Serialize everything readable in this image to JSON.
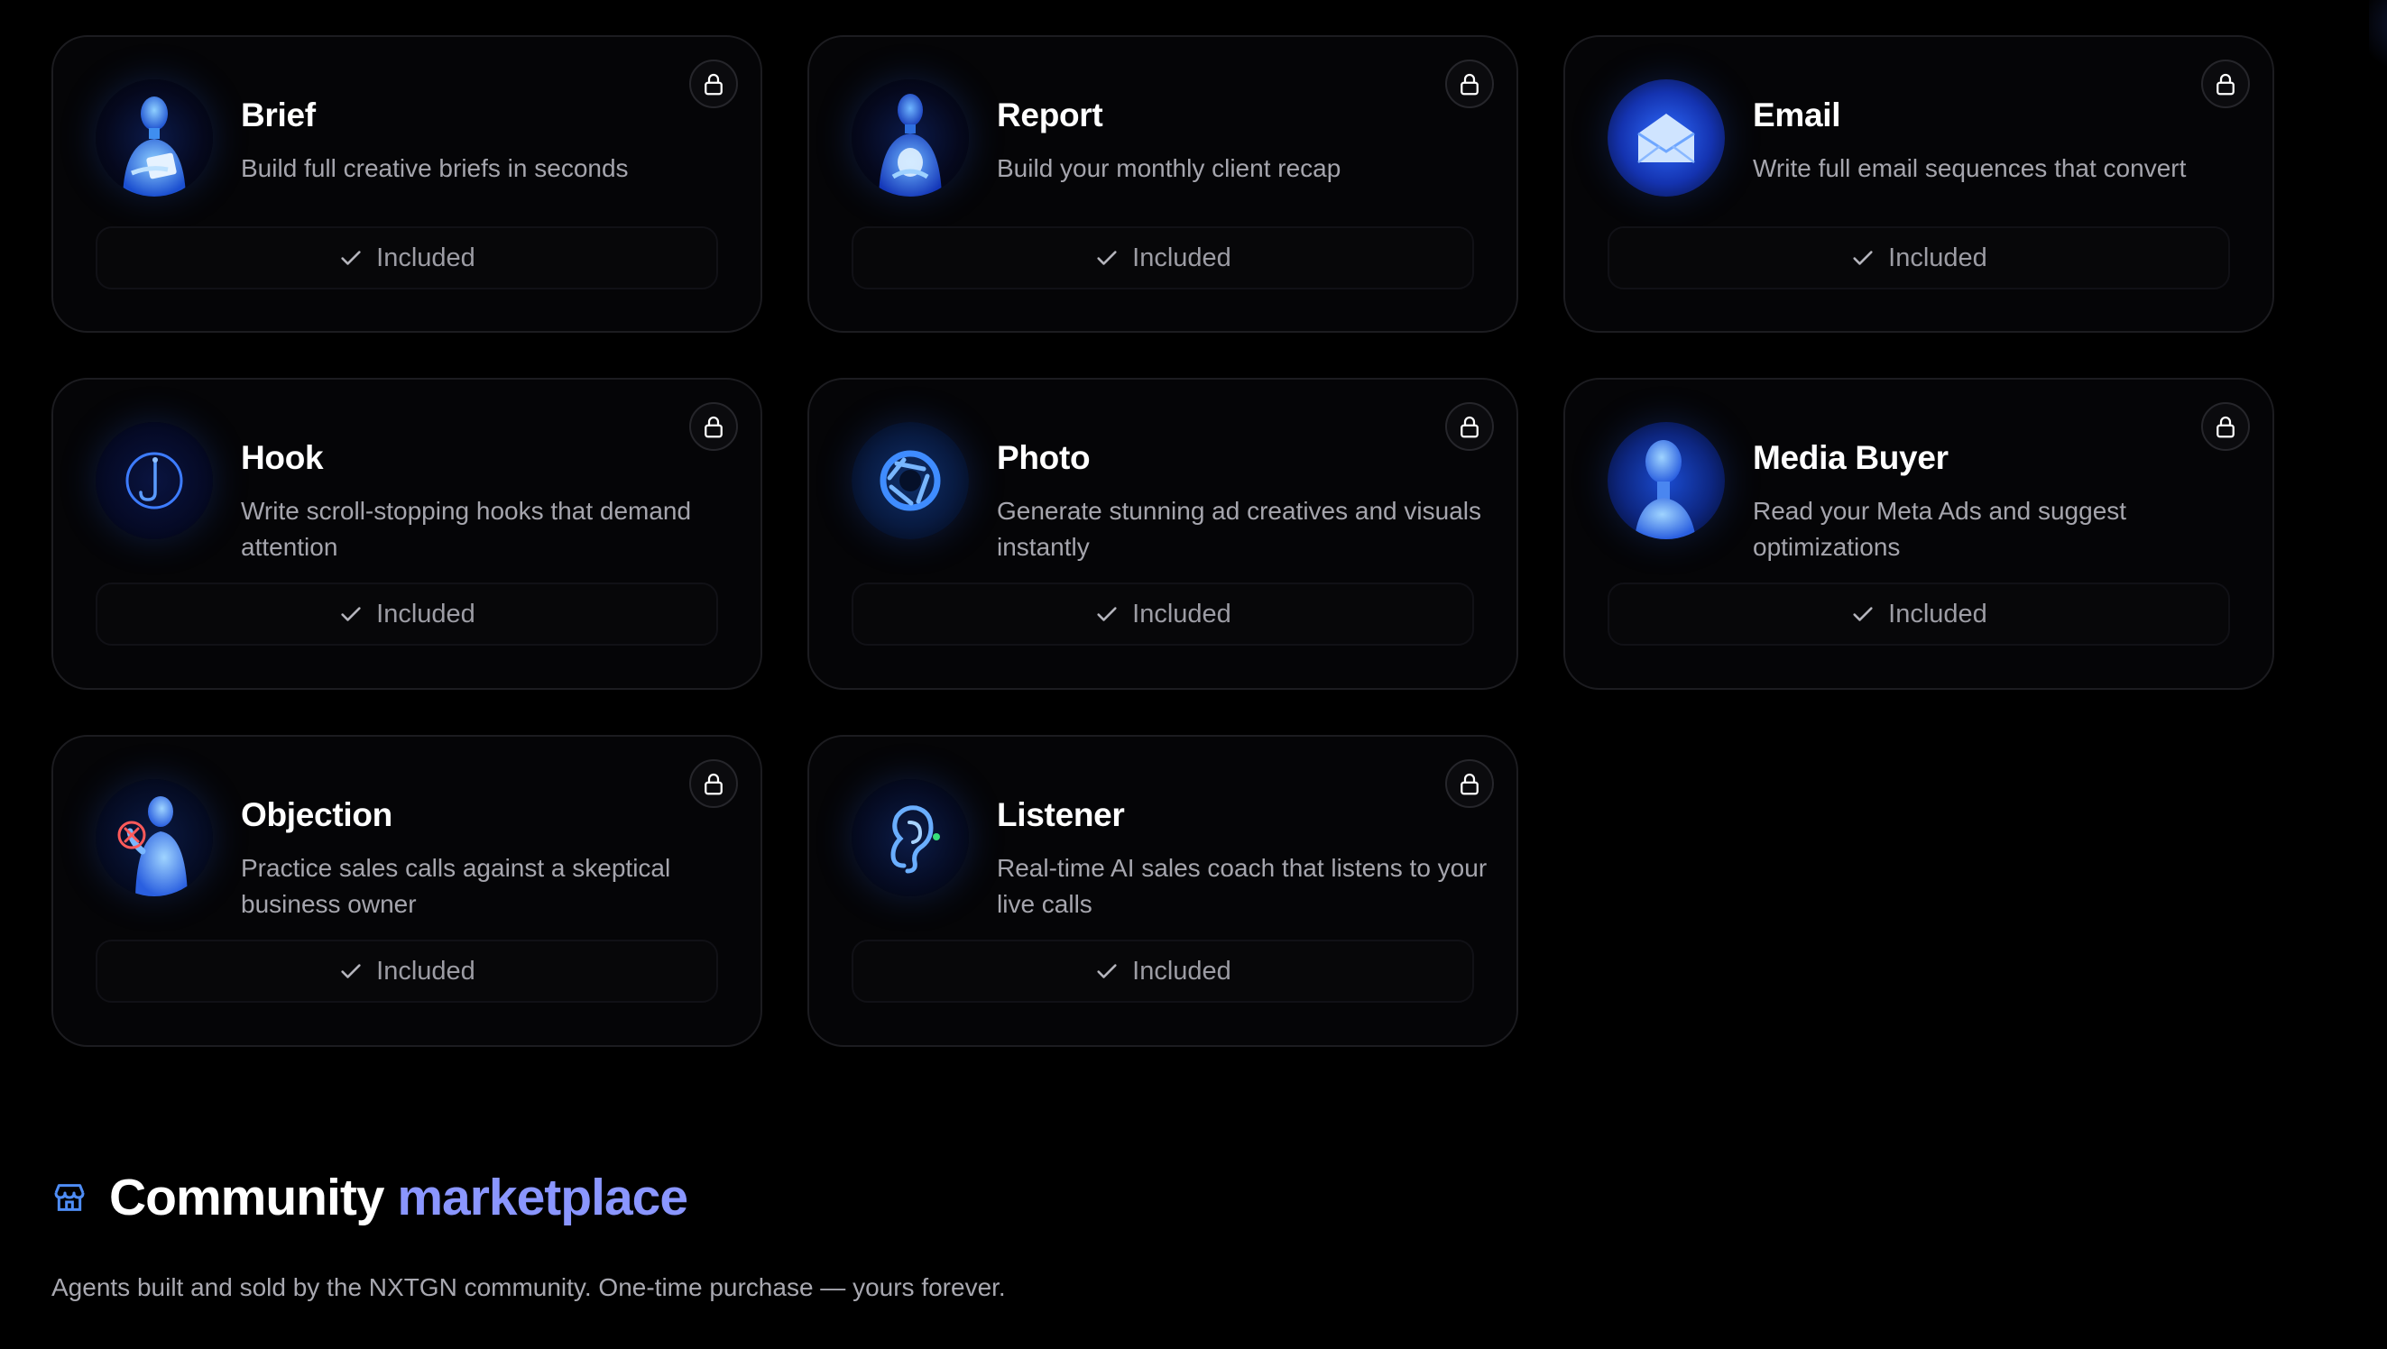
{
  "agents": [
    {
      "name": "Brief",
      "description": "Build full creative briefs in seconds",
      "status": "Included",
      "icon": "humanoid-holding-paper-icon"
    },
    {
      "name": "Report",
      "description": "Build your monthly client recap",
      "status": "Included",
      "icon": "humanoid-glowing-chest-icon"
    },
    {
      "name": "Email",
      "description": "Write full email sequences that convert",
      "status": "Included",
      "icon": "envelope-icon"
    },
    {
      "name": "Hook",
      "description": "Write scroll-stopping hooks that demand attention",
      "status": "Included",
      "icon": "fishing-hook-icon"
    },
    {
      "name": "Photo",
      "description": "Generate stunning ad creatives and visuals instantly",
      "status": "Included",
      "icon": "camera-aperture-icon"
    },
    {
      "name": "Media Buyer",
      "description": "Read your Meta Ads and suggest optimizations",
      "status": "Included",
      "icon": "humanoid-head-icon"
    },
    {
      "name": "Objection",
      "description": "Practice sales calls against a skeptical business owner",
      "status": "Included",
      "icon": "humanoid-rejecting-icon"
    },
    {
      "name": "Listener",
      "description": "Real-time AI sales coach that listens to your live calls",
      "status": "Included",
      "icon": "ear-icon"
    }
  ],
  "marketplace": {
    "title_prefix": "Community",
    "title_accent": "marketplace",
    "subtitle": "Agents built and sold by the NXTGN community. One-time purchase — yours forever.",
    "icon": "storefront-icon"
  },
  "colors": {
    "background": "#000000",
    "card_border": "#1c1c20",
    "accent": "#8a96ff",
    "store_icon": "#4f8df5",
    "muted_text": "#a5a5ad"
  }
}
